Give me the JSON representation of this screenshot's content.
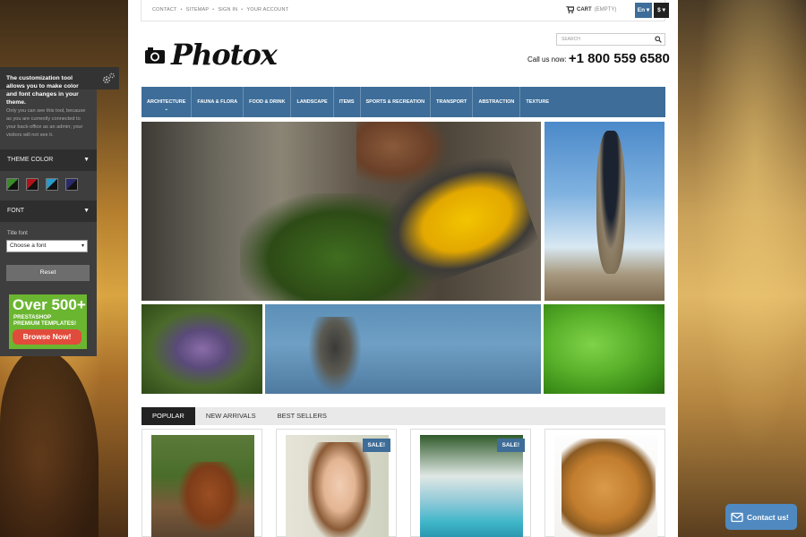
{
  "topbar": {
    "links": [
      "CONTACT",
      "SITEMAP",
      "SIGN IN",
      "YOUR ACCOUNT"
    ],
    "cart_label": "CART",
    "cart_status": "(EMPTY)",
    "language": "En",
    "currency": "$"
  },
  "header": {
    "logo_text": "Photox",
    "search_placeholder": "SEARCH",
    "call_label": "Call us now:",
    "phone": "+1 800 559 6580"
  },
  "menu": {
    "items": [
      "ARCHITECTURE",
      "FAUNA & FLORA",
      "FOOD & DRINK",
      "LANDSCAPE",
      "ITEMS",
      "SPORTS & RECREATION",
      "TRANSPORT",
      "ABSTRACTION",
      "TEXTURE"
    ]
  },
  "tabs": [
    "POPULAR",
    "NEW ARRIVALS",
    "BEST SELLERS"
  ],
  "products": {
    "sale_label": "SALE!"
  },
  "panel": {
    "title": "The customization tool allows you to make color and font changes in your theme.",
    "note": "Only you can see this tool, because as you are currently connected to your back-office as an admin; your visitors will not see it.",
    "theme_color_label": "THEME COLOR",
    "swatches": [
      "#3a8a2a",
      "#b0121a",
      "#2a9ac8",
      "#2a2a6a"
    ],
    "font_label": "FONT",
    "title_font_label": "Title font",
    "font_select_value": "Choose a font",
    "reset_label": "Reset",
    "promo_big": "Over 500+",
    "promo_line1": "PRESTASHOP",
    "promo_line2": "PREMIUM TEMPLATES!",
    "promo_button": "Browse Now!"
  },
  "contact": {
    "label": "Contact us!"
  },
  "colors": {
    "accent": "#3d6d98",
    "promo_green": "#6bb631",
    "promo_red": "#e14b3b"
  }
}
